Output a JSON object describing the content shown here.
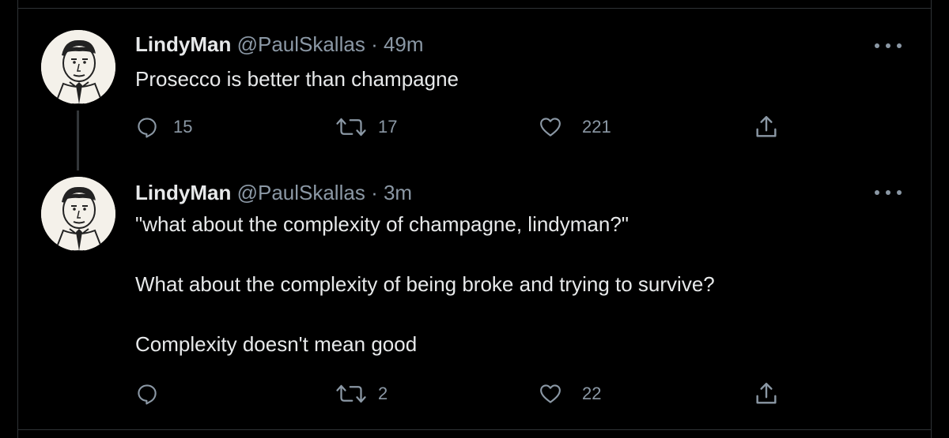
{
  "tweets": [
    {
      "author_name": "LindyMan",
      "handle": "@PaulSkallas",
      "separator": "·",
      "time": "49m",
      "text": [
        "Prosecco is better than champagne"
      ],
      "reply_count": "15",
      "retweet_count": "17",
      "like_count": "221",
      "icons": [
        "reply-icon",
        "retweet-icon",
        "like-icon",
        "share-icon",
        "more-icon"
      ]
    },
    {
      "author_name": "LindyMan",
      "handle": "@PaulSkallas",
      "separator": "·",
      "time": "3m",
      "text": [
        "\"what about the complexity of champagne, lindyman?\"",
        "What about the complexity of being broke and trying to survive?",
        "Complexity doesn't mean good"
      ],
      "reply_count": "",
      "retweet_count": "2",
      "like_count": "22",
      "icons": [
        "reply-icon",
        "retweet-icon",
        "like-icon",
        "share-icon",
        "more-icon"
      ]
    }
  ],
  "colors": {
    "background": "#000000",
    "primary_text": "#e7e9ea",
    "secondary_text": "#8b98a5",
    "divider": "#2f3336"
  }
}
